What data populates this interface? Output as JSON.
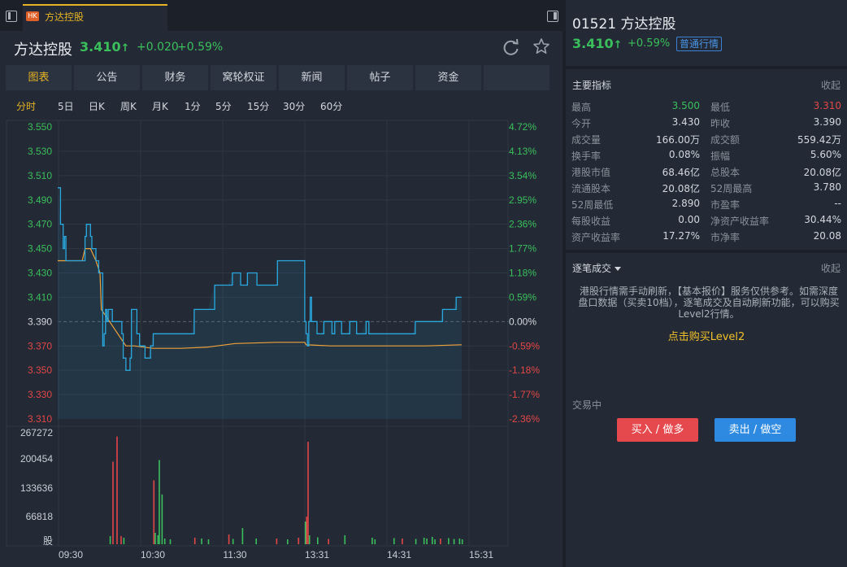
{
  "tab": {
    "badge": "HK",
    "name": "方达控股"
  },
  "header": {
    "name": "方达控股",
    "price": "3.410",
    "arrow": "↑",
    "change": "+0.020",
    "pct": "+0.59%"
  },
  "nav": [
    "图表",
    "公告",
    "财务",
    "窝轮权证",
    "新闻",
    "帖子",
    "资金",
    ""
  ],
  "periods": [
    "分时",
    "5日",
    "日K",
    "周K",
    "月K",
    "1分",
    "5分",
    "15分",
    "30分",
    "60分"
  ],
  "chart_data": {
    "type": "line",
    "prev_close": 3.39,
    "price_ticks": [
      "3.550",
      "3.530",
      "3.510",
      "3.490",
      "3.470",
      "3.450",
      "3.430",
      "3.410",
      "3.390",
      "3.370",
      "3.350",
      "3.330",
      "3.310"
    ],
    "pct_ticks": [
      "4.72%",
      "4.13%",
      "3.54%",
      "2.95%",
      "2.36%",
      "1.77%",
      "1.18%",
      "0.59%",
      "0.00%",
      "-0.59%",
      "-1.18%",
      "-1.77%",
      "-2.36%"
    ],
    "ylim": [
      3.31,
      3.55
    ],
    "x_labels": [
      "09:30",
      "10:30",
      "11:30",
      "13:31",
      "14:31",
      "15:31"
    ],
    "volume_ticks": [
      "267272",
      "200454",
      "133636",
      "66818",
      "股"
    ],
    "volume_max": 267272,
    "price_series": [
      [
        0,
        3.5
      ],
      [
        2,
        3.47
      ],
      [
        4,
        3.45
      ],
      [
        5,
        3.46
      ],
      [
        6,
        3.44
      ],
      [
        8,
        3.44
      ],
      [
        12,
        3.44
      ],
      [
        16,
        3.44
      ],
      [
        19,
        3.44
      ],
      [
        20,
        3.46
      ],
      [
        21,
        3.47
      ],
      [
        23,
        3.47
      ],
      [
        24,
        3.46
      ],
      [
        25,
        3.45
      ],
      [
        27,
        3.45
      ],
      [
        28,
        3.44
      ],
      [
        30,
        3.43
      ],
      [
        32,
        3.43
      ],
      [
        33,
        3.37
      ],
      [
        34,
        3.38
      ],
      [
        35,
        3.4
      ],
      [
        36,
        3.39
      ],
      [
        37,
        3.4
      ],
      [
        39,
        3.4
      ],
      [
        40,
        3.39
      ],
      [
        42,
        3.39
      ],
      [
        44,
        3.39
      ],
      [
        46,
        3.39
      ],
      [
        47,
        3.38
      ],
      [
        48,
        3.36
      ],
      [
        49,
        3.36
      ],
      [
        50,
        3.35
      ],
      [
        52,
        3.35
      ],
      [
        53,
        3.36
      ],
      [
        54,
        3.4
      ],
      [
        56,
        3.4
      ],
      [
        58,
        3.38
      ],
      [
        60,
        3.37
      ],
      [
        62,
        3.37
      ],
      [
        64,
        3.36
      ],
      [
        66,
        3.36
      ],
      [
        68,
        3.37
      ],
      [
        70,
        3.38
      ],
      [
        72,
        3.38
      ],
      [
        80,
        3.38
      ],
      [
        90,
        3.38
      ],
      [
        95,
        3.38
      ],
      [
        98,
        3.38
      ],
      [
        100,
        3.4
      ],
      [
        104,
        3.4
      ],
      [
        110,
        3.4
      ],
      [
        115,
        3.42
      ],
      [
        125,
        3.42
      ],
      [
        128,
        3.43
      ],
      [
        133,
        3.43
      ],
      [
        134,
        3.42
      ],
      [
        138,
        3.42
      ],
      [
        139,
        3.43
      ],
      [
        145,
        3.43
      ],
      [
        146,
        3.42
      ],
      [
        160,
        3.42
      ],
      [
        161,
        3.44
      ],
      [
        175,
        3.44
      ],
      [
        180,
        3.44
      ],
      [
        181,
        3.39
      ],
      [
        182,
        3.38
      ],
      [
        183,
        3.37
      ],
      [
        184,
        3.39
      ],
      [
        185,
        3.41
      ],
      [
        186,
        3.39
      ],
      [
        188,
        3.39
      ],
      [
        190,
        3.38
      ],
      [
        193,
        3.38
      ],
      [
        195,
        3.39
      ],
      [
        200,
        3.39
      ],
      [
        201,
        3.38
      ],
      [
        203,
        3.39
      ],
      [
        206,
        3.39
      ],
      [
        208,
        3.38
      ],
      [
        212,
        3.38
      ],
      [
        214,
        3.39
      ],
      [
        217,
        3.39
      ],
      [
        219,
        3.38
      ],
      [
        222,
        3.38
      ],
      [
        226,
        3.39
      ],
      [
        228,
        3.38
      ],
      [
        232,
        3.38
      ],
      [
        245,
        3.38
      ],
      [
        247,
        3.38
      ],
      [
        260,
        3.38
      ],
      [
        262,
        3.39
      ],
      [
        268,
        3.39
      ],
      [
        275,
        3.39
      ],
      [
        280,
        3.39
      ],
      [
        282,
        3.4
      ],
      [
        288,
        3.4
      ],
      [
        290,
        3.4
      ],
      [
        292,
        3.41
      ],
      [
        296,
        3.41
      ]
    ],
    "avg_series": [
      [
        0,
        3.44
      ],
      [
        10,
        3.44
      ],
      [
        18,
        3.44
      ],
      [
        20,
        3.45
      ],
      [
        24,
        3.45
      ],
      [
        28,
        3.44
      ],
      [
        31,
        3.43
      ],
      [
        32,
        3.4
      ],
      [
        38,
        3.39
      ],
      [
        44,
        3.38
      ],
      [
        50,
        3.37
      ],
      [
        56,
        3.37
      ],
      [
        70,
        3.368
      ],
      [
        90,
        3.368
      ],
      [
        110,
        3.369
      ],
      [
        130,
        3.372
      ],
      [
        160,
        3.373
      ],
      [
        181,
        3.373
      ],
      [
        182,
        3.371
      ],
      [
        200,
        3.37
      ],
      [
        240,
        3.37
      ],
      [
        270,
        3.37
      ],
      [
        296,
        3.371
      ]
    ],
    "volume_bars": [
      [
        38,
        12000,
        "g"
      ],
      [
        40,
        196000,
        "r"
      ],
      [
        43,
        258000,
        "r"
      ],
      [
        46,
        12000,
        "r"
      ],
      [
        48,
        8000,
        "g"
      ],
      [
        70,
        150000,
        "r"
      ],
      [
        71,
        20000,
        "g"
      ],
      [
        73,
        14000,
        "g"
      ],
      [
        74,
        200000,
        "g"
      ],
      [
        76,
        115000,
        "g"
      ],
      [
        78,
        6000,
        "g"
      ],
      [
        82,
        4000,
        "g"
      ],
      [
        100,
        8000,
        "r"
      ],
      [
        105,
        6000,
        "g"
      ],
      [
        110,
        4000,
        "g"
      ],
      [
        125,
        16000,
        "r"
      ],
      [
        128,
        5000,
        "g"
      ],
      [
        135,
        32000,
        "g"
      ],
      [
        145,
        6000,
        "g"
      ],
      [
        160,
        6000,
        "r"
      ],
      [
        168,
        4000,
        "g"
      ],
      [
        176,
        8000,
        "r"
      ],
      [
        181,
        48000,
        "g"
      ],
      [
        182,
        60000,
        "r"
      ],
      [
        183,
        245000,
        "r"
      ],
      [
        184,
        14000,
        "g"
      ],
      [
        190,
        9000,
        "g"
      ],
      [
        198,
        5000,
        "r"
      ],
      [
        210,
        14000,
        "g"
      ],
      [
        230,
        8000,
        "g"
      ],
      [
        232,
        4000,
        "g"
      ],
      [
        246,
        7000,
        "g"
      ],
      [
        252,
        6000,
        "r"
      ],
      [
        262,
        5000,
        "g"
      ],
      [
        268,
        8000,
        "g"
      ],
      [
        270,
        6000,
        "g"
      ],
      [
        274,
        10000,
        "g"
      ],
      [
        276,
        4000,
        "g"
      ],
      [
        280,
        6000,
        "r"
      ],
      [
        286,
        7000,
        "g"
      ],
      [
        290,
        5000,
        "g"
      ],
      [
        294,
        6000,
        "g"
      ],
      [
        296,
        4000,
        "g"
      ]
    ],
    "colors": {
      "price": "#2aa9e0",
      "avg": "#f0a23a",
      "up": "#e24747",
      "down": "#3bbf5c",
      "grid": "#2e3744"
    }
  },
  "right": {
    "code": "01521",
    "name": "方达控股",
    "price": "3.410",
    "arrow": "↑",
    "pct": "+0.59%",
    "badge": "普通行情",
    "key_metrics_title": "主要指标",
    "collapse": "收起",
    "metrics": [
      {
        "l1": "最高",
        "v1": "3.500",
        "c1": "green",
        "l2": "最低",
        "v2": "3.310",
        "c2": "red"
      },
      {
        "l1": "今开",
        "v1": "3.430",
        "c1": "",
        "l2": "昨收",
        "v2": "3.390",
        "c2": ""
      },
      {
        "l1": "成交量",
        "v1": "166.00万",
        "c1": "",
        "l2": "成交额",
        "v2": "559.42万",
        "c2": ""
      },
      {
        "l1": "换手率",
        "v1": "0.08%",
        "c1": "",
        "l2": "振幅",
        "v2": "5.60%",
        "c2": ""
      },
      {
        "l1": "港股市值",
        "v1": "68.46亿",
        "c1": "",
        "l2": "总股本",
        "v2": "20.08亿",
        "c2": ""
      },
      {
        "l1": "流通股本",
        "v1": "20.08亿",
        "c1": "",
        "l2": "52周最高",
        "v2": "3.780",
        "c2": ""
      },
      {
        "l1": "52周最低",
        "v1": "2.890",
        "c1": "",
        "l2": "市盈率",
        "v2": "--",
        "c2": ""
      },
      {
        "l1": "每股收益",
        "v1": "0.00",
        "c1": "",
        "l2": "净资产收益率",
        "v2": "30.44%",
        "c2": ""
      },
      {
        "l1": "资产收益率",
        "v1": "17.27%",
        "c1": "",
        "l2": "市净率",
        "v2": "20.08",
        "c2": ""
      }
    ],
    "ticks_title": "逐笔成交",
    "notice": "港股行情需手动刷新，【基本报价】服务仅供参考。如需深度盘口数据（买卖10档），逐笔成交及自动刷新功能，可以购买Level2行情。",
    "level2_link": "点击购买Level2",
    "status": "交易中",
    "buy_label": "买入 / 做多",
    "sell_label": "卖出 / 做空"
  }
}
